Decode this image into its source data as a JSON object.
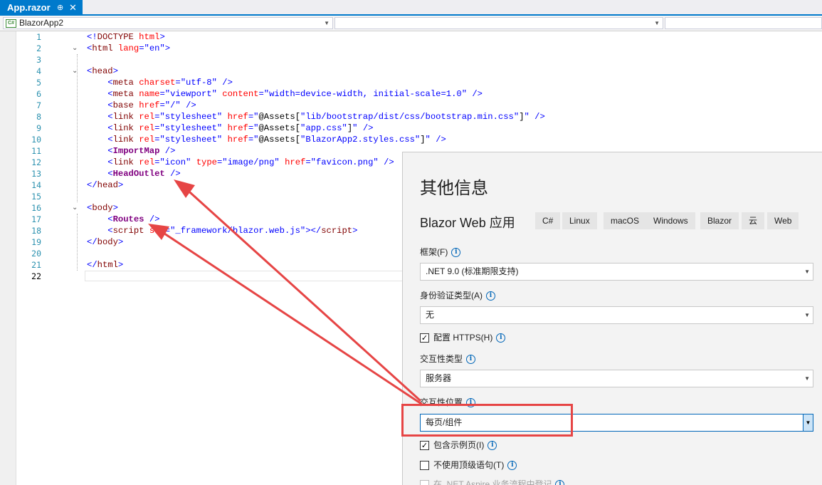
{
  "tab": {
    "title": "App.razor",
    "pin": "⊕",
    "close": "✕"
  },
  "navbar": {
    "project": "BlazorApp2",
    "project_badge": "C#"
  },
  "editor": {
    "line_numbers": [
      "1",
      "2",
      "3",
      "4",
      "5",
      "6",
      "7",
      "8",
      "9",
      "10",
      "11",
      "12",
      "13",
      "14",
      "15",
      "16",
      "17",
      "18",
      "19",
      "20",
      "21",
      "22"
    ]
  },
  "dialog": {
    "title": "其他信息",
    "template_name": "Blazor Web 应用",
    "tags": [
      "C#",
      "Linux",
      "macOS",
      "Windows",
      "Blazor",
      "云",
      "Web"
    ],
    "framework_label": "框架(F)",
    "framework_value": ".NET 9.0 (标准期限支持)",
    "auth_label": "身份验证类型(A)",
    "auth_value": "无",
    "https_label": "配置 HTTPS(H)",
    "interactivity_type_label": "交互性类型",
    "interactivity_type_value": "服务器",
    "interactivity_location_label": "交互性位置",
    "interactivity_location_value": "每页/组件",
    "sample_pages_label": "包含示例页(I)",
    "top_level_label": "不使用顶级语句(T)",
    "aspire_label": "在 .NET Aspire 业务流程中登记",
    "info_glyph": "i",
    "check_glyph": "✓"
  },
  "colors": {
    "accent": "#007acc",
    "annotation": "#e64545"
  }
}
